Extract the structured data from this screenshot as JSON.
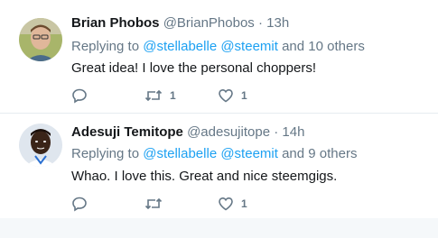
{
  "colors": {
    "accent": "#1da1f2",
    "secondary_text": "#657786",
    "primary_text": "#14171a",
    "divider": "#e6ecf0"
  },
  "tweets": [
    {
      "name": "Brian Phobos",
      "handle": "@BrianPhobos",
      "separator": "·",
      "time": "13h",
      "reply_prefix": "Replying to",
      "mentions": [
        "@stellabelle",
        "@steemit"
      ],
      "reply_suffix": "and 10 others",
      "text": "Great idea! I love the personal choppers!",
      "reply_count": "",
      "retweet_count": "1",
      "like_count": "1",
      "icons": {
        "reply": "reply-icon",
        "retweet": "retweet-icon",
        "like": "heart-icon"
      }
    },
    {
      "name": "Adesuji Temitope",
      "handle": "@adesujitope",
      "separator": "·",
      "time": "14h",
      "reply_prefix": "Replying to",
      "mentions": [
        "@stellabelle",
        "@steemit"
      ],
      "reply_suffix": "and 9 others",
      "text": "Whao. I love this. Great and nice steemgigs.",
      "reply_count": "",
      "retweet_count": "",
      "like_count": "1",
      "icons": {
        "reply": "reply-icon",
        "retweet": "retweet-icon",
        "like": "heart-icon"
      }
    }
  ]
}
